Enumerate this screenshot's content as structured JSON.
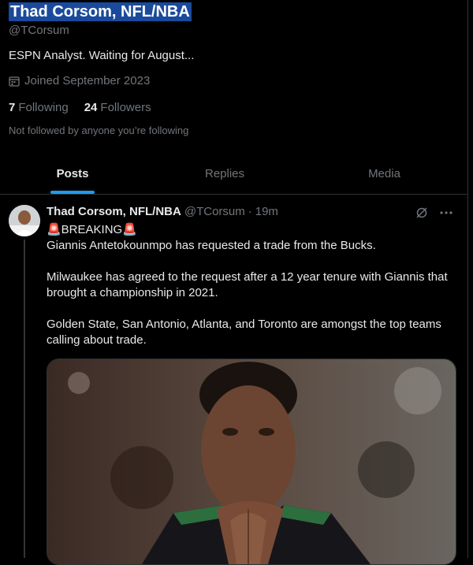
{
  "profile": {
    "name": "Thad Corsom, NFL/NBA",
    "handle": "@TCorsum",
    "bio": "ESPN Analyst. Waiting for August...",
    "joined": "Joined September 2023",
    "following_count": "7",
    "following_label": "Following",
    "followers_count": "24",
    "followers_label": "Followers",
    "not_followed": "Not followed by anyone you’re following"
  },
  "tabs": [
    {
      "label": "Posts",
      "active": true
    },
    {
      "label": "Replies",
      "active": false
    },
    {
      "label": "Media",
      "active": false
    }
  ],
  "tweet": {
    "author_name": "Thad Corsom, NFL/NBA",
    "author_handle": "@TCorsum",
    "separator": "·",
    "time": "19m",
    "breaking": "🚨BREAKING🚨",
    "line1": "Giannis Antetokounmpo has requested a trade from the Bucks.",
    "line2": "Milwaukee has agreed to the request after a 12 year tenure with Giannis that brought a championship in 2021.",
    "line3": "Golden State, San Antonio, Atlanta, and Toronto are amongst the top teams calling about trade."
  },
  "colors": {
    "background": "#000000",
    "accent": "#1d9bf0",
    "secondary_text": "#71767b",
    "name_highlight": "#1a4a9c"
  }
}
